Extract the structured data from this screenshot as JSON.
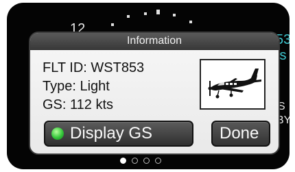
{
  "background": {
    "top_value": "12",
    "right_top": "53",
    "right_mid": "ts",
    "right_s": "S",
    "right_by": "BY"
  },
  "dialog": {
    "title": "Information",
    "flt_id": "FLT ID: WST853",
    "type": "Type: Light",
    "gs": "GS:  112 kts",
    "display_gs_label": "Display GS",
    "done_label": "Done",
    "display_gs_indicator_color": "#34c63a"
  },
  "pager": {
    "count": 4,
    "active_index": 0
  }
}
